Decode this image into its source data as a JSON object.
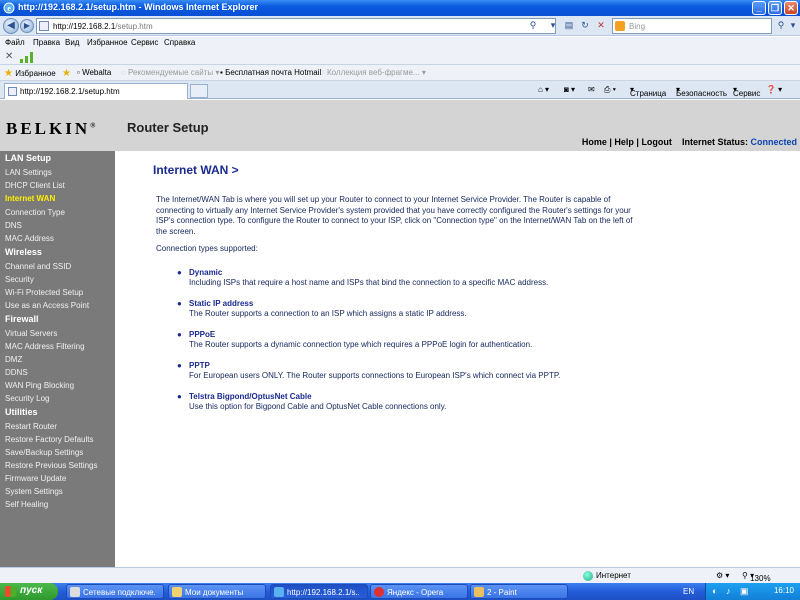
{
  "window": {
    "title": "http://192.168.2.1/setup.htm - Windows Internet Explorer"
  },
  "address_bar": {
    "url_host": "http://192.168.2.1",
    "url_path": "/setup.htm",
    "search_placeholder": "Bing"
  },
  "menu": [
    "Файл",
    "Правка",
    "Вид",
    "Избранное",
    "Сервис",
    "Справка"
  ],
  "favorites_bar": {
    "favorites_label": "Избранное",
    "items": [
      "Webalta",
      "Рекомендуемые сайты",
      "Бесплатная почта Hotmail",
      "Коллекция веб-фрагме..."
    ]
  },
  "tab": {
    "title": "http://192.168.2.1/setup.htm"
  },
  "tab_tools": {
    "page": "Страница",
    "safety": "Безопасность",
    "tools": "Сервис"
  },
  "router": {
    "brand": "BELKIN",
    "brand_mark": "®",
    "app_title": "Router Setup",
    "header_links": {
      "home": "Home",
      "help": "Help",
      "logout": "Logout",
      "internet_status_label": "Internet Status:",
      "internet_status_value": "Connected"
    }
  },
  "sidebar": {
    "sections": [
      {
        "title": "LAN Setup",
        "items": [
          "LAN Settings",
          "DHCP Client List"
        ]
      },
      {
        "title": "Internet WAN",
        "items": [
          "Connection Type",
          "DNS",
          "MAC Address"
        ]
      },
      {
        "title": "Wireless",
        "items": [
          "Channel and SSID",
          "Security",
          "Wi-Fi Protected Setup",
          "Use as an Access Point"
        ]
      },
      {
        "title": "Firewall",
        "items": [
          "Virtual Servers",
          "MAC Address Filtering",
          "DMZ",
          "DDNS",
          "WAN Ping Blocking",
          "Security Log"
        ]
      },
      {
        "title": "Utilities",
        "items": [
          "Restart Router",
          "Restore Factory Defaults",
          "Save/Backup Settings",
          "Restore Previous Settings",
          "Firmware Update",
          "System Settings",
          "Self Healing"
        ]
      }
    ],
    "active_item": "Internet WAN",
    "active_color": "#ffee00"
  },
  "content": {
    "title": "Internet WAN >",
    "intro": "The Internet/WAN Tab is where you will set up your Router to connect to your Internet Service Provider. The Router is capable of connecting to virtually any Internet Service Provider's system provided that you have correctly configured the Router's settings for your ISP's connection type. To configure the Router to connect to your ISP, click on \"Connection type\" on the Internet/WAN Tab on the left of the screen.",
    "supported_label": "Connection types supported:",
    "types": [
      {
        "name": "Dynamic",
        "desc": "Including ISPs that require a host name and ISPs that bind the connection to a specific MAC address."
      },
      {
        "name": "Static IP address",
        "desc": "The Router supports a connection to an ISP which assigns a static IP address."
      },
      {
        "name": "PPPoE",
        "desc": "The Router supports a dynamic connection type which requires a PPPoE login for authentication."
      },
      {
        "name": "PPTP",
        "desc": "For European users ONLY. The Router supports connections to European ISP's which connect via PPTP."
      },
      {
        "name": "Telstra Bigpond/OptusNet Cable",
        "desc": "Use this option for Bigpond Cable and OptusNet Cable connections only."
      }
    ]
  },
  "status_bar": {
    "zone": "Интернет",
    "zoom": "130%"
  },
  "taskbar": {
    "start": "пуск",
    "tasks": [
      "Сетевые подключе...",
      "Мои документы",
      "http://192.168.2.1/s...",
      "Яндекс - Opera",
      "2 - Paint"
    ],
    "active_task": 2,
    "language": "EN",
    "clock": "16:10"
  }
}
